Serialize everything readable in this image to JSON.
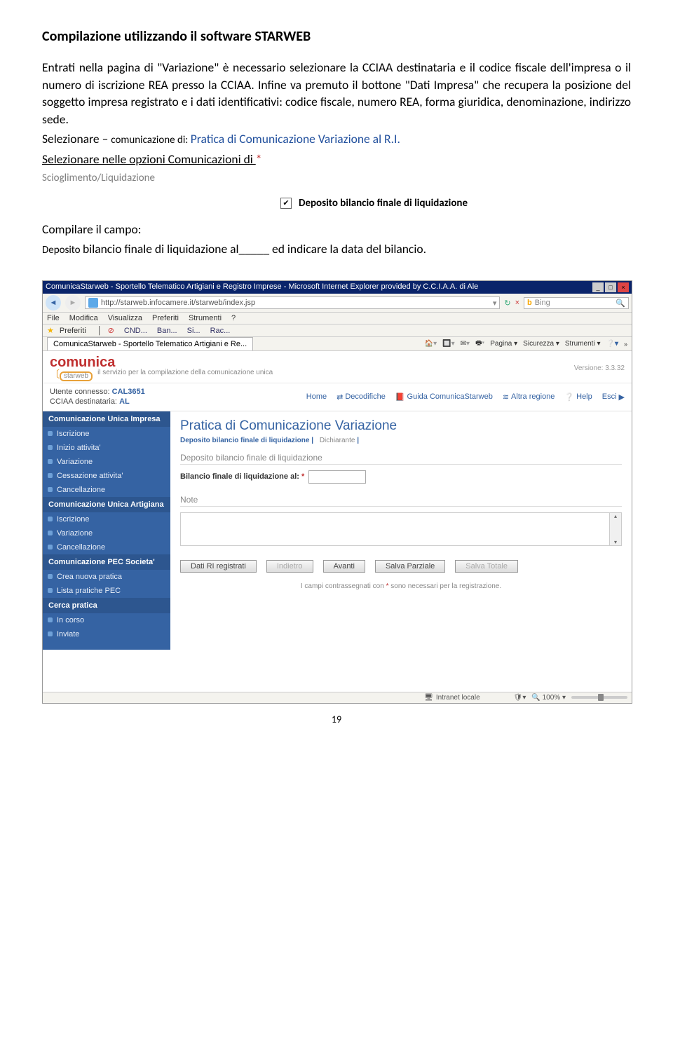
{
  "doc": {
    "title": "Compilazione utilizzando il software STARWEB",
    "p1a": "Entrati nella pagina di \"Variazione\" è necessario selezionare la CCIAA destinataria e il codice fiscale dell'impresa o il numero di iscrizione REA presso la CCIAA. Infine va premuto il bottone \"Dati Impresa\" che recupera la posizione del soggetto impresa registrato e i dati identificativi: codice fiscale, numero REA, forma giuridica, denominazione, indirizzo sede.",
    "p2a": "Selezionare – ",
    "p2b": "comunicazione di: ",
    "p2c": "Pratica di Comunicazione Variazione al R.I.",
    "p3a": "Selezionare nelle opzioni Comunicazioni di ",
    "p3b": "*",
    "p4": "Scioglimento/Liquidazione",
    "cb_label": "Deposito bilancio finale di liquidazione",
    "p5": "Compilare il campo:",
    "p6a": "Deposito ",
    "p6b": "bilancio finale di liquidazione al_____ ed indicare la data del bilancio."
  },
  "ie": {
    "title": "ComunicaStarweb - Sportello Telematico Artigiani e Registro Imprese - Microsoft Internet Explorer provided by C.C.I.A.A. di Ale",
    "url": "http://starweb.infocamere.it/starweb/index.jsp",
    "search_engine": "Bing",
    "menu": [
      "File",
      "Modifica",
      "Visualizza",
      "Preferiti",
      "Strumenti",
      "?"
    ],
    "fav_label": "Preferiti",
    "favs": [
      "CND...",
      "Ban...",
      "Si...",
      "Rac..."
    ],
    "tab": "ComunicaStarweb - Sportello Telematico Artigiani e Re...",
    "tools": [
      "Pagina",
      "Sicurezza",
      "Strumenti"
    ],
    "status_zone": "Intranet locale",
    "zoom": "100%"
  },
  "app": {
    "brand1": "comunica",
    "brand2": "starweb",
    "tagline": "il servizio per la compilazione della comunicazione unica",
    "version": "Versione: 3.3.32",
    "user_label": "Utente connesso: ",
    "user": "CAL3651",
    "dest_label": "CCIAA destinataria: ",
    "dest": "AL",
    "nav": {
      "home": "Home",
      "decod": "Decodifiche",
      "guida": "Guida ComunicaStarweb",
      "regione": "Altra regione",
      "help": "Help",
      "esci": "Esci"
    },
    "side": {
      "s1": "Comunicazione Unica Impresa",
      "s1i": [
        "Iscrizione",
        "Inizio attivita'",
        "Variazione",
        "Cessazione attivita'",
        "Cancellazione"
      ],
      "s2": "Comunicazione Unica Artigiana",
      "s2i": [
        "Iscrizione",
        "Variazione",
        "Cancellazione"
      ],
      "s3": "Comunicazione PEC Societa'",
      "s3i": [
        "Crea nuova pratica",
        "Lista pratiche PEC"
      ],
      "s4": "Cerca pratica",
      "s4i": [
        "In corso",
        "Inviate"
      ]
    },
    "content": {
      "h2": "Pratica di Comunicazione Variazione",
      "bc1": "Deposito bilancio finale di liquidazione",
      "bc2": "Dichiarante",
      "sec1": "Deposito bilancio finale di liquidazione",
      "field": "Bilancio finale di liquidazione al:",
      "note": "Note",
      "btn1": "Dati RI registrati",
      "btn2": "Indietro",
      "btn3": "Avanti",
      "btn4": "Salva Parziale",
      "btn5": "Salva Totale",
      "foot1": "I campi contrassegnati con ",
      "foot2": " sono necessari per la registrazione."
    }
  },
  "page_number": "19"
}
